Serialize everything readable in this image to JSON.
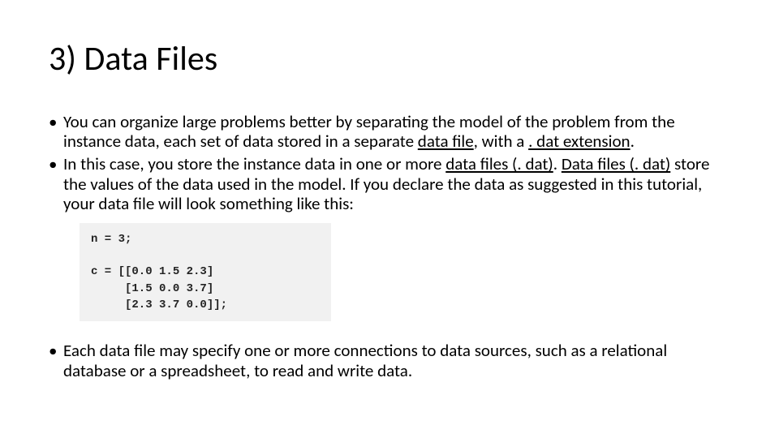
{
  "title": "3) Data Files",
  "bullets": {
    "b1": {
      "pre": "You can organize large problems better by separating the model of the problem from the instance data, each set of data stored in a separate ",
      "u1": "data file",
      "mid": ", with a ",
      "u2": ". dat extension",
      "post": "."
    },
    "b2": {
      "pre": "In this case, you store the instance data in one or more ",
      "u1": "data files (. dat)",
      "mid": ". ",
      "u2": "Data files (. dat)",
      "post": " store the values of the data used in the model. If you declare the data as suggested in this tutorial, your data file will look something like this:"
    },
    "b3": "Each data file may specify one or more connections to data sources, such as a relational database or a spreadsheet, to read and write data."
  },
  "code": "n = 3;\n\nc = [[0.0 1.5 2.3]\n     [1.5 0.0 3.7]\n     [2.3 3.7 0.0]];"
}
